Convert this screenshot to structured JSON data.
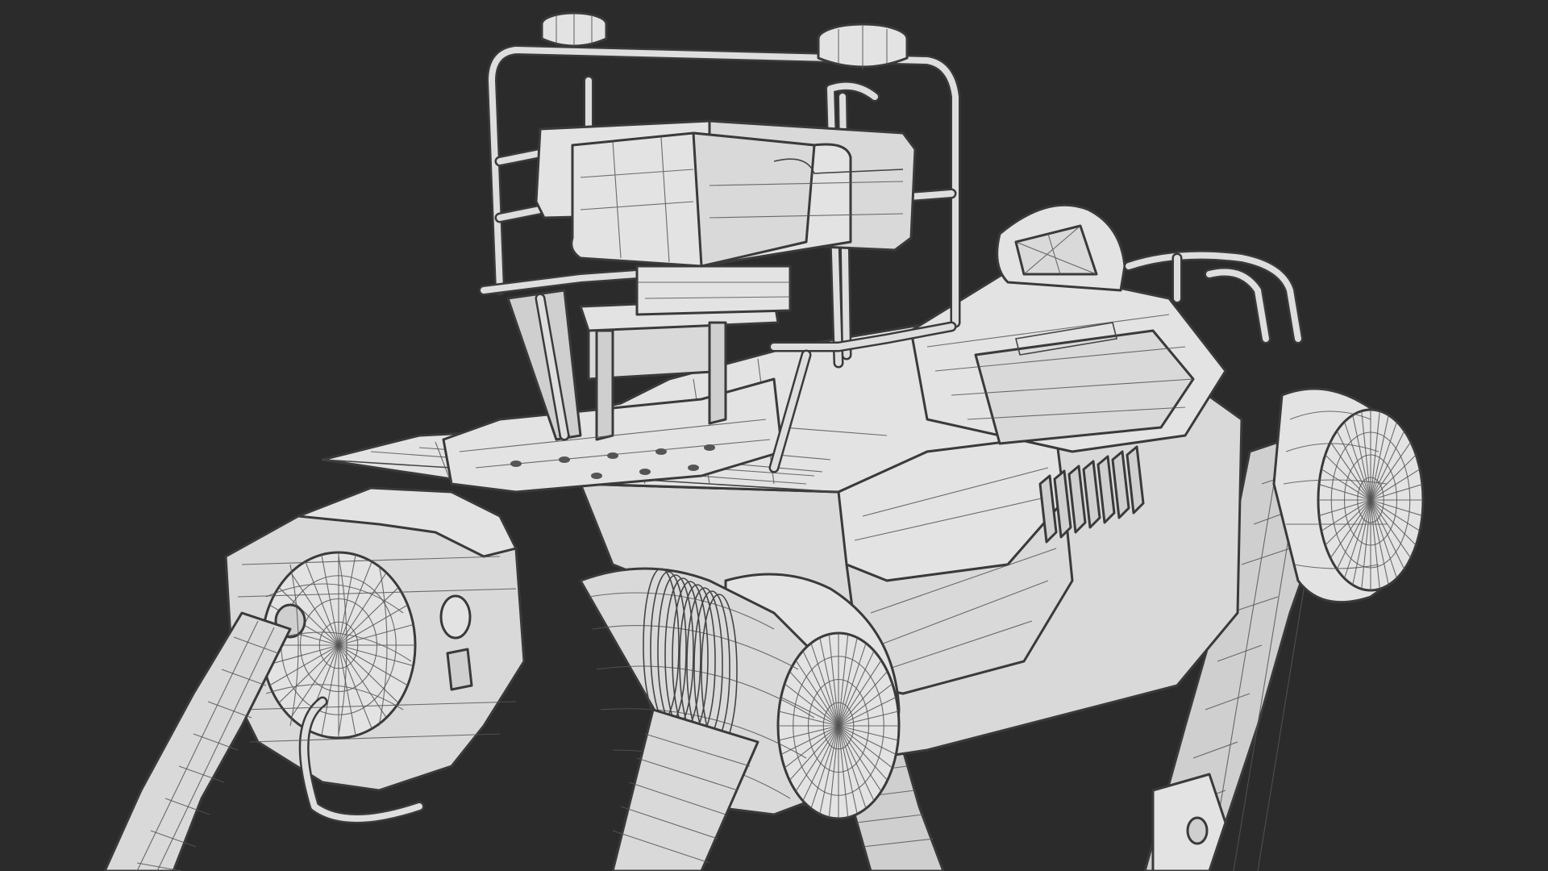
{
  "scene": {
    "kind": "3d-wireframe-render",
    "subject": "quadruped-robot",
    "background_color": "#2b2b2b",
    "model_fill_color": "#d9d9d9",
    "wire_color": "#3a3a3a"
  }
}
